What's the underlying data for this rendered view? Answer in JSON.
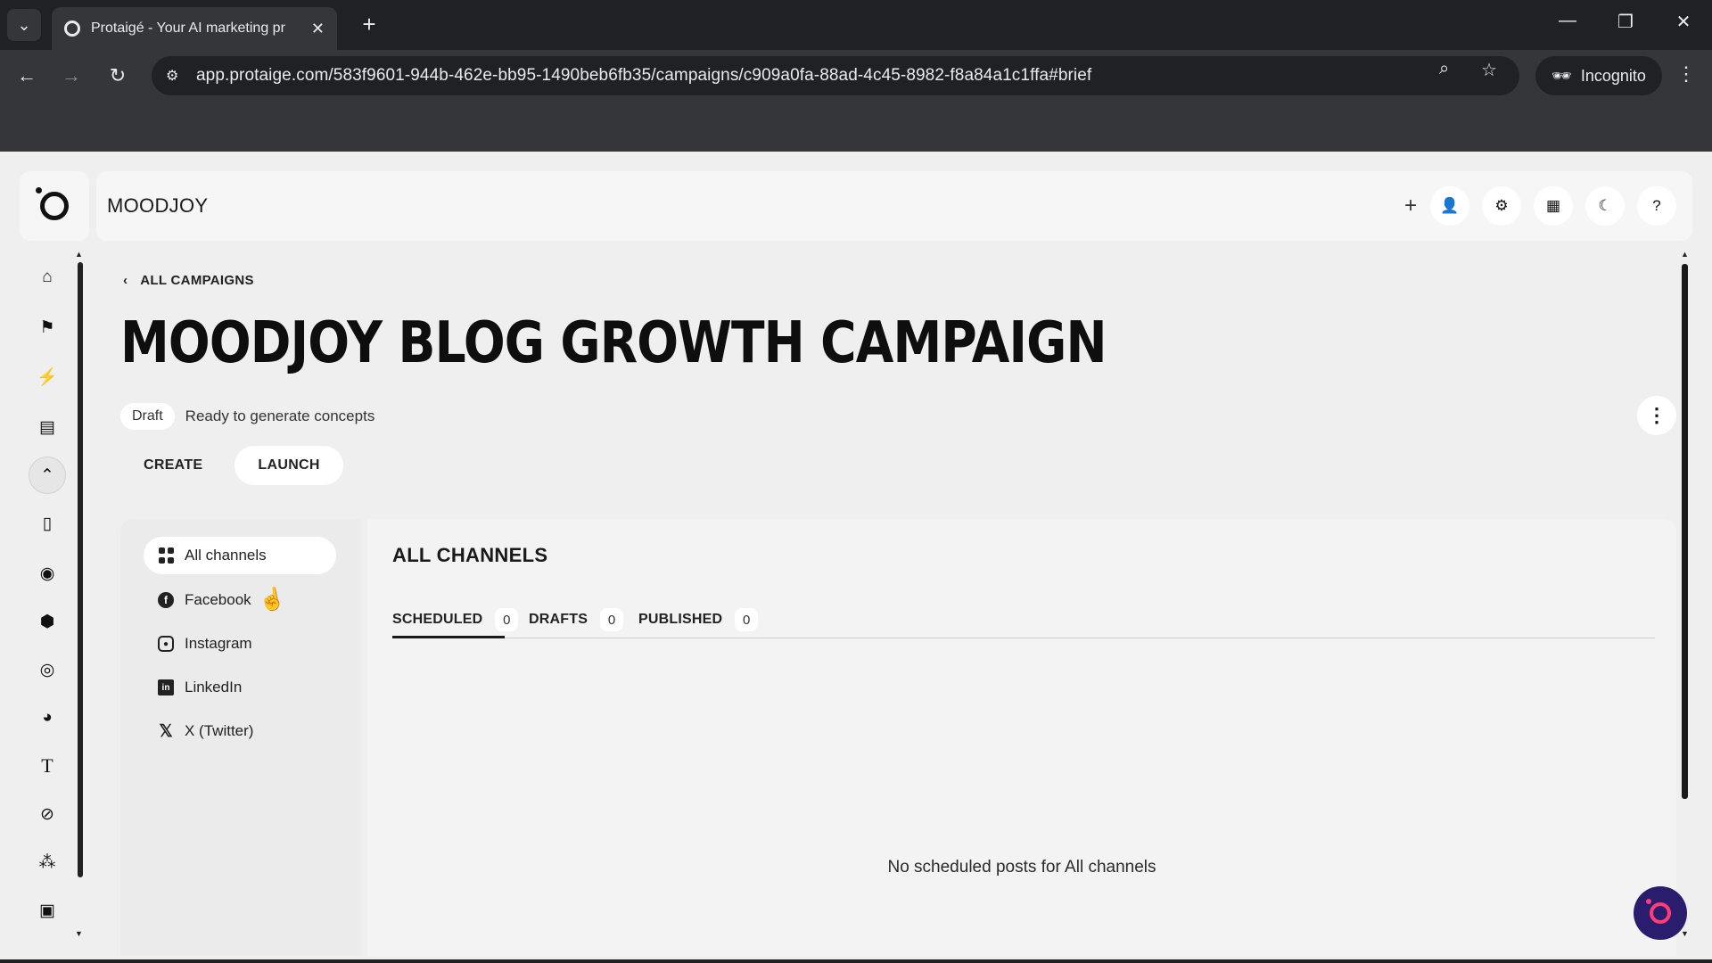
{
  "browser": {
    "tab_title": "Protaigé - Your AI marketing pr",
    "url": "app.protaige.com/583f9601-944b-462e-bb95-1490beb6fb35/campaigns/c909a0fa-88ad-4c45-8982-f8a84a1c1ffa#brief",
    "incognito_label": "Incognito"
  },
  "header": {
    "workspace_name": "MOODJOY",
    "icons": [
      "plus-icon",
      "user-icon",
      "settings-icon",
      "grid-icon",
      "moon-icon",
      "help-icon"
    ]
  },
  "sidebar": {
    "icons": [
      "home-icon",
      "campaign-icon",
      "lightning-icon",
      "book-icon",
      "collapse-icon",
      "document-icon",
      "profile-icon",
      "box-icon",
      "target-icon",
      "palette-icon",
      "text-icon",
      "brush-icon",
      "audience-icon",
      "image-icon"
    ]
  },
  "page": {
    "back_label": "ALL CAMPAIGNS",
    "title": "MOODJOY BLOG GROWTH CAMPAIGN",
    "status_badge": "Draft",
    "status_text": "Ready to generate concepts"
  },
  "mode_tabs": {
    "create": "CREATE",
    "launch": "LAUNCH",
    "active": "launch"
  },
  "channels": {
    "items": [
      {
        "label": "All channels",
        "icon": "grid-icon",
        "active": true
      },
      {
        "label": "Facebook",
        "icon": "facebook-icon",
        "active": false
      },
      {
        "label": "Instagram",
        "icon": "instagram-icon",
        "active": false
      },
      {
        "label": "LinkedIn",
        "icon": "linkedin-icon",
        "active": false
      },
      {
        "label": "X (Twitter)",
        "icon": "x-icon",
        "active": false
      }
    ]
  },
  "content": {
    "title": "ALL CHANNELS",
    "tabs": [
      {
        "label": "SCHEDULED",
        "count": "0",
        "active": true
      },
      {
        "label": "DRAFTS",
        "count": "0",
        "active": false
      },
      {
        "label": "PUBLISHED",
        "count": "0",
        "active": false
      }
    ],
    "empty_message": "No scheduled posts for All channels"
  },
  "colors": {
    "app_background": "#efefef",
    "chat_fab": "#2a1d6e",
    "chat_accent": "#ff3c78"
  }
}
